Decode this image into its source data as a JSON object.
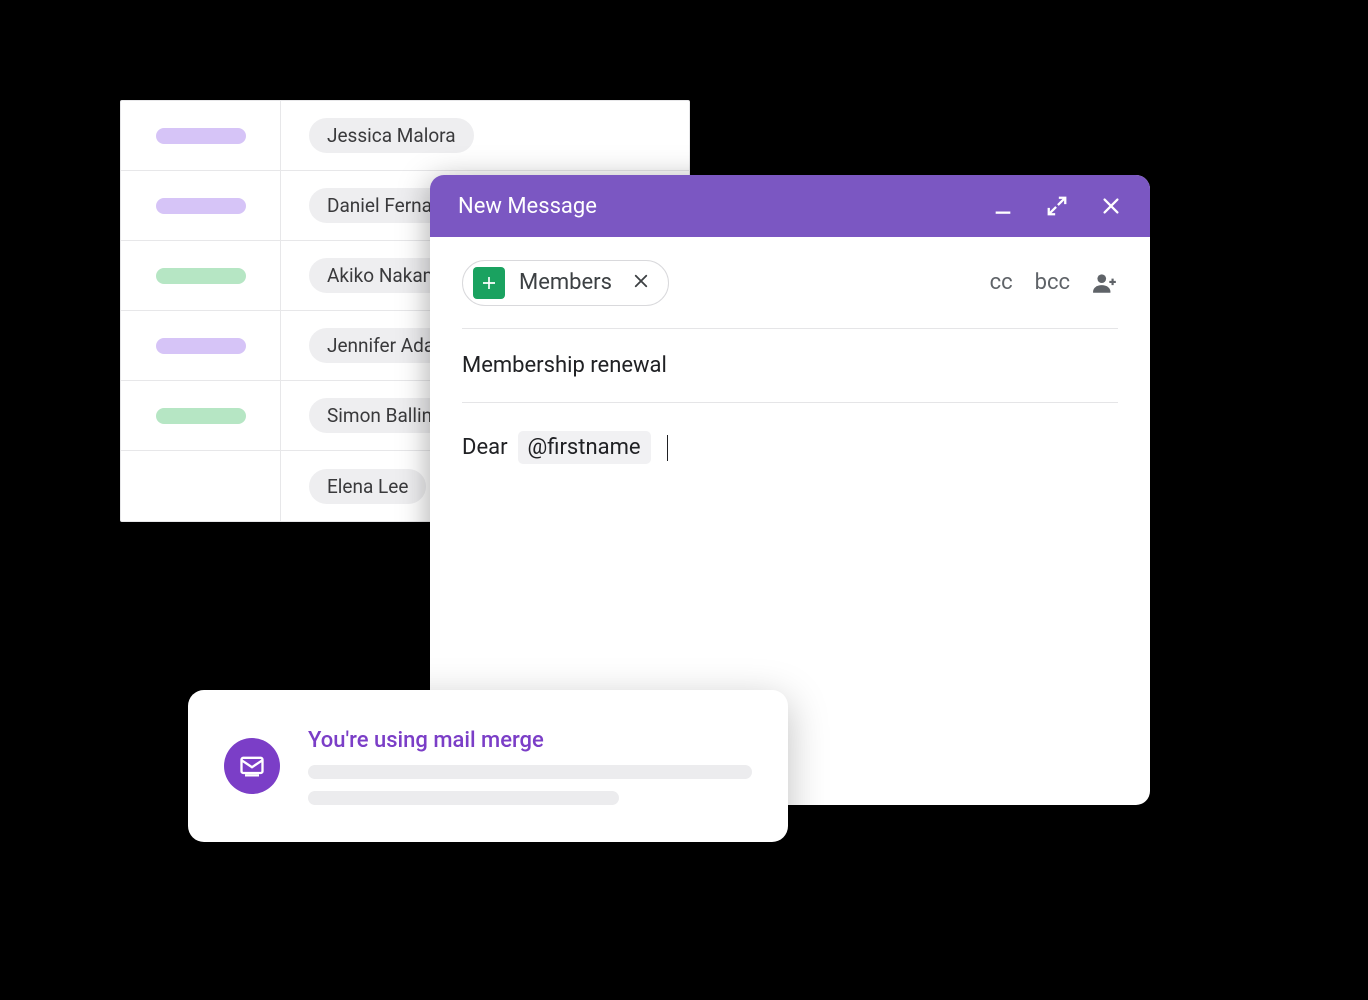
{
  "sheet": {
    "rows": [
      {
        "color": "purple",
        "name": "Jessica Malora"
      },
      {
        "color": "purple",
        "name": "Daniel Fernandez"
      },
      {
        "color": "green",
        "name": "Akiko Nakamura"
      },
      {
        "color": "purple",
        "name": "Jennifer Adams"
      },
      {
        "color": "green",
        "name": "Simon Ballinger"
      },
      {
        "color": "",
        "name": "Elena Lee"
      }
    ]
  },
  "compose": {
    "title": "New Message",
    "to_chip_label": "Members",
    "cc": "cc",
    "bcc": "bcc",
    "subject": "Membership renewal",
    "body_prefix": "Dear",
    "merge_token": "@firstname"
  },
  "toast": {
    "title": "You're using mail merge"
  }
}
